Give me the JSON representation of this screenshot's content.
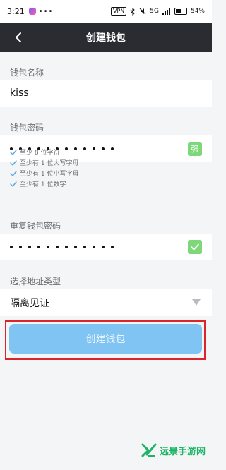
{
  "status_bar": {
    "time": "3:21",
    "more": "•••",
    "vpn": "VPN",
    "network": "5G",
    "battery": "54%"
  },
  "header": {
    "title": "创建钱包",
    "back_icon": "chevron-left-icon"
  },
  "wallet_name": {
    "label": "钱包名称",
    "value": "kiss"
  },
  "wallet_password": {
    "label": "钱包密码",
    "masked_length": 12,
    "strength_label": "强",
    "strength_color": "#7ed87a"
  },
  "password_rules": [
    "至少 8 位字符",
    "至少有 1 位大写字母",
    "至少有 1 位小写字母",
    "至少有 1 位数字"
  ],
  "repeat_password": {
    "label": "重复钱包密码",
    "masked_length": 12,
    "match_icon": "check-icon"
  },
  "address_type": {
    "label": "选择地址类型",
    "value": "隔离见证",
    "caret_icon": "triangle-down-icon"
  },
  "create_button": {
    "label": "创建钱包",
    "color": "#7fc4f2",
    "highlight_color": "#d9252b"
  },
  "watermark": {
    "text": "远景手游网"
  }
}
